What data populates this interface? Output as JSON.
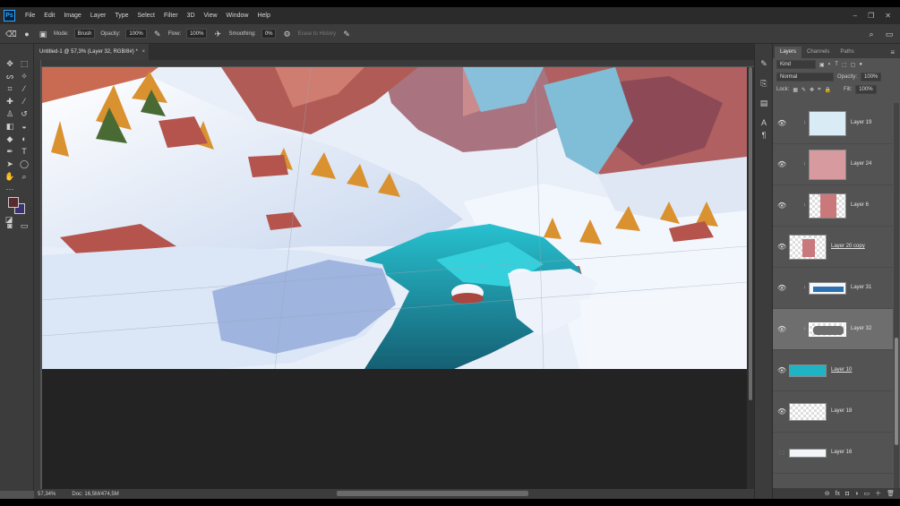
{
  "menubar": {
    "logo": "Ps",
    "items": [
      "File",
      "Edit",
      "Image",
      "Layer",
      "Type",
      "Select",
      "Filter",
      "3D",
      "View",
      "Window",
      "Help"
    ],
    "window_controls": [
      "–",
      "❐",
      "✕"
    ]
  },
  "options": {
    "mode_label": "Mode:",
    "mode_value": "Brush",
    "opacity_label": "Opacity:",
    "opacity_value": "100%",
    "flow_label": "Flow:",
    "flow_value": "100%",
    "smoothing_label": "Smoothing:",
    "smoothing_value": "0%",
    "erase_to_history": "Erase to History"
  },
  "document": {
    "tab_title": "Untitled-1 @ 57,3% (Layer 32, RGB/8#) *",
    "close": "×",
    "zoom": "57,34%",
    "doc_size": "Doc: 16,5M/474,5M"
  },
  "panel": {
    "tabs": [
      "Layers",
      "Channels",
      "Paths"
    ],
    "active_tab": "Layers",
    "filter_kind": "Kind",
    "blend_mode": "Normal",
    "opacity_label": "Opacity:",
    "opacity_value": "100%",
    "lock_label": "Lock:",
    "fill_label": "Fill:",
    "fill_value": "100%",
    "footer_icons": [
      "⊖",
      "fx",
      "◘",
      "◑",
      "▭",
      "＋",
      "🗑"
    ]
  },
  "layers": [
    {
      "name": "Layer 19",
      "clipped": true,
      "selected": false,
      "underlined": false,
      "thumb": "light-blue"
    },
    {
      "name": "Layer 24",
      "clipped": true,
      "selected": false,
      "underlined": false,
      "thumb": "pink-rock"
    },
    {
      "name": "Layer 6",
      "clipped": true,
      "selected": false,
      "underlined": false,
      "thumb": "pink-cliff"
    },
    {
      "name": "Layer 20 copy",
      "clipped": false,
      "selected": false,
      "underlined": true,
      "thumb": "pink-transparent"
    },
    {
      "name": "Layer 31",
      "clipped": true,
      "selected": false,
      "underlined": false,
      "thumb": "blue-strokes"
    },
    {
      "name": "Layer 32",
      "clipped": true,
      "selected": true,
      "underlined": false,
      "thumb": "grey-smoke"
    },
    {
      "name": "Layer 10",
      "clipped": false,
      "selected": false,
      "underlined": true,
      "thumb": "teal-fill"
    },
    {
      "name": "Layer 18",
      "clipped": false,
      "selected": false,
      "underlined": false,
      "thumb": "transparent"
    },
    {
      "name": "Layer 16",
      "clipped": false,
      "selected": false,
      "underlined": false,
      "thumb": "white-strip"
    }
  ],
  "colors": {
    "foreground": "#5a2b2e",
    "background": "#3a3270",
    "water": "#1fb3c4",
    "snow": "#eef3fb",
    "rock": "#b4544d"
  }
}
